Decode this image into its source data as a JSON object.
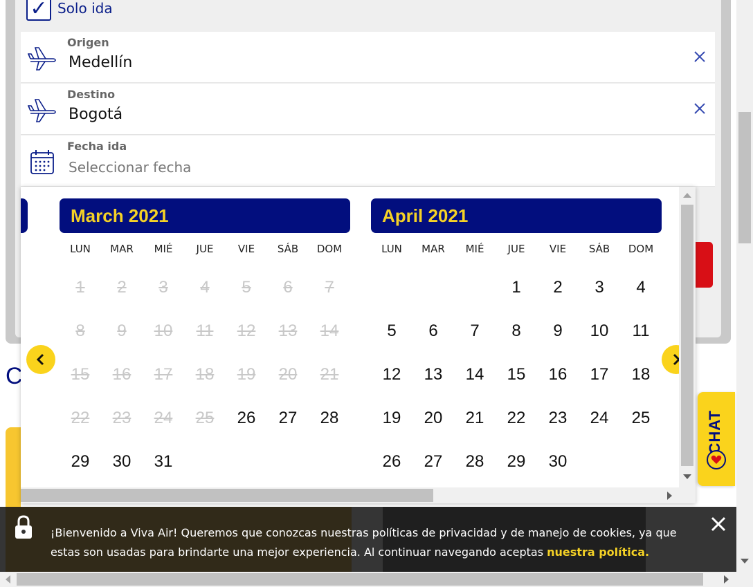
{
  "trip": {
    "one_way_label": "Solo ida",
    "one_way_checked": "✓"
  },
  "fields": {
    "origin": {
      "label": "Origen",
      "value": "Medellín",
      "icon": "plane-icon"
    },
    "destination": {
      "label": "Destino",
      "value": "Bogotá",
      "icon": "plane-icon"
    },
    "departure": {
      "label": "Fecha ida",
      "placeholder": "Seleccionar fecha",
      "icon": "calendar-icon"
    }
  },
  "calendar": {
    "weekdays": [
      "LUN",
      "MAR",
      "MIÉ",
      "JUE",
      "VIE",
      "SÁB",
      "DOM"
    ],
    "months": [
      {
        "title": "March 2021",
        "first_weekday_index": 0,
        "days": 31,
        "disabled_until": 25
      },
      {
        "title": "April 2021",
        "first_weekday_index": 3,
        "days": 30,
        "disabled_until": 0
      }
    ],
    "colors": {
      "header_bg": "#020e7e",
      "header_text": "#f5d226",
      "nav_bg": "#fad31c",
      "disabled": "#c8c8c8"
    }
  },
  "partial_heading": "C",
  "cookie": {
    "message": "¡Bienvenido a Viva Air! Queremos que conozcas nuestras políticas de privacidad y de manejo de cookies, ya que estas son usadas para brindarte una mejor experiencia. Al continuar navegando aceptas",
    "policy_link": "nuestra política."
  },
  "chat": {
    "label": "CHAT"
  }
}
